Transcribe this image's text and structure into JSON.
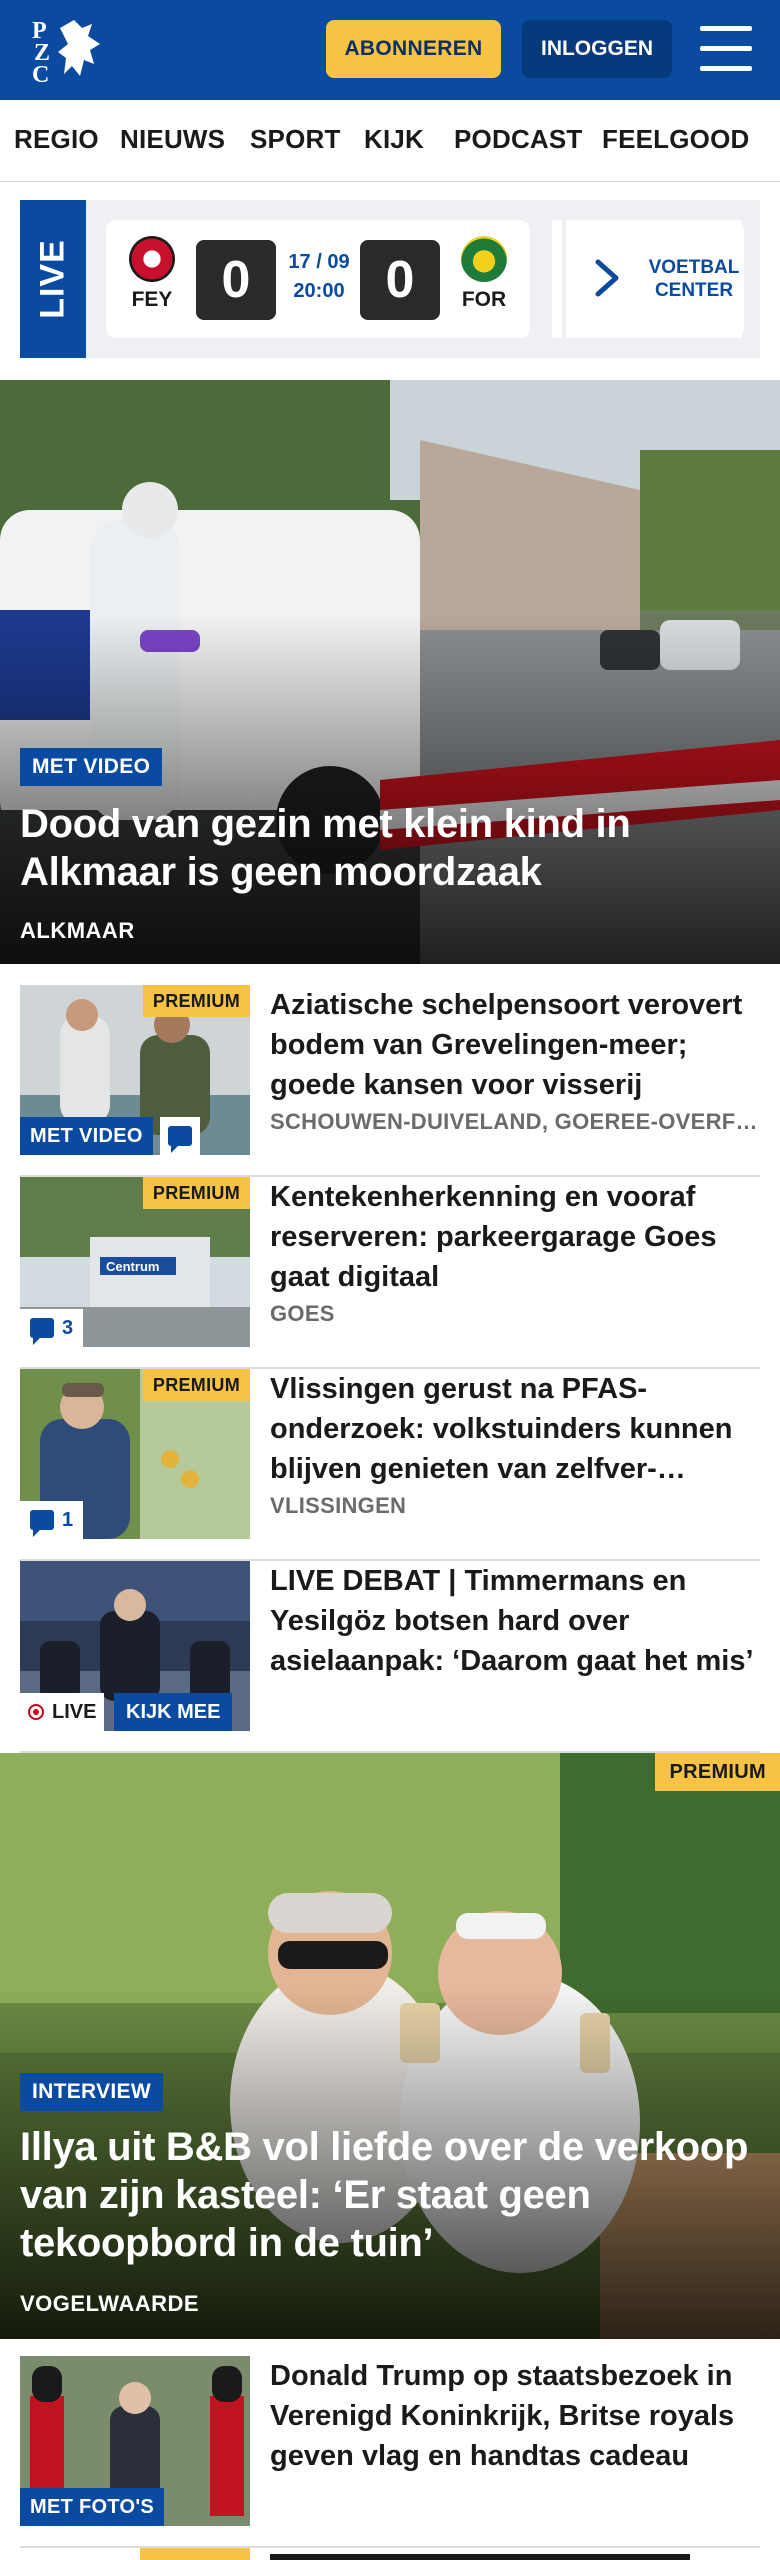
{
  "header": {
    "logo_text": "PZC",
    "subscribe_label": "ABONNEREN",
    "login_label": "INLOGGEN",
    "menu_icon": "hamburger-icon",
    "background_color": "#0a4aa0",
    "accent_color": "#f6c344"
  },
  "nav": {
    "items": [
      "REGIO",
      "NIEUWS",
      "SPORT",
      "KIJK",
      "PODCAST",
      "FEELGOOD"
    ]
  },
  "live": {
    "tag": "LIVE",
    "home_team": "FEY",
    "away_team": "FOR",
    "home_score": "0",
    "away_score": "0",
    "date": "17 / 09",
    "time": "20:00",
    "next_icon": "chevron-right-icon",
    "center_line1": "VOETBAL",
    "center_line2": "CENTER"
  },
  "hero1": {
    "label": "MET VIDEO",
    "title": "Dood van gezin met klein kind in Alkmaar is geen moordzaak",
    "location": "ALKMAAR"
  },
  "articles": [
    {
      "premium": "PREMIUM",
      "title": "Aziatische schelpensoort verovert bodem van Grevelingen-meer; goede kansen voor visserij",
      "location": "SCHOUWEN-DUIVELAND, GOEREE-OVERFLAKKEE",
      "video": "MET VIDEO"
    },
    {
      "premium": "PREMIUM",
      "title": "Kentekenherkenning en vooraf reserveren: parkeergarage Goes gaat digitaal",
      "location": "GOES",
      "comments": "3"
    },
    {
      "premium": "PREMIUM",
      "title": "Vlissingen gerust na PFAS-onderzoek: volkstuinders kunnen blijven genieten van zelfver-bouwde groenten",
      "location": "VLISSINGEN",
      "comments": "1"
    },
    {
      "title": "LIVE DEBAT | Timmermans en Yesilgöz botsen hard over asielaanpak: ‘Daarom gaat het mis’",
      "live": "LIVE",
      "watch": "KIJK MEE"
    }
  ],
  "hero2": {
    "premium": "PREMIUM",
    "label": "INTERVIEW",
    "title": "Illya uit B&B vol liefde over de verkoop van zijn kasteel: ‘Er staat geen tekoopbord in de tuin’",
    "location": "VOGELWAARDE"
  },
  "article5": {
    "title": "Donald Trump op staatsbezoek in Verenigd Koninkrijk, Britse royals geven vlag en handtas cadeau",
    "photos": "MET FOTO'S"
  },
  "article6": {
    "premium": "PREMIUM"
  }
}
